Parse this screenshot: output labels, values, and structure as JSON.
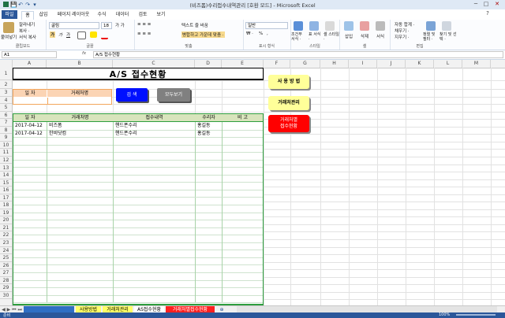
{
  "window": {
    "title": "(비즈폼)수리접수내역관리 [호환 모드] - Microsoft Excel"
  },
  "quick_access": {
    "save": "💾",
    "undo": "↶",
    "redo": "↷",
    "customize": "▾"
  },
  "window_controls": {
    "minimize": "─",
    "restore": "□",
    "close": "✕"
  },
  "ribbon_tabs": [
    "파일",
    "홈",
    "삽입",
    "페이지 레이아웃",
    "수식",
    "데이터",
    "검토",
    "보기"
  ],
  "ribbon": {
    "clipboard": {
      "paste": "붙여넣기",
      "cut": "잘라내기",
      "copy": "복사 ·",
      "format_painter": "서식 복사",
      "label": "클립보드"
    },
    "font": {
      "name": "굴림",
      "size": "18",
      "bold": "가",
      "italic": "가",
      "underline": "가",
      "label": "글꼴"
    },
    "alignment": {
      "wrap": "텍스트 줄 바꿈",
      "merge": "병합하고 가운데 맞춤 ·",
      "label": "맞춤"
    },
    "number": {
      "format": "일반",
      "currency": "₩ ·",
      "percent": "%",
      "comma": ",",
      "label": "표시 형식"
    },
    "styles": {
      "conditional": "조건부 서식 ·",
      "table": "표 서식 ·",
      "cell": "셀 스타일 ·",
      "label": "스타일"
    },
    "cells": {
      "insert": "삽입",
      "delete": "삭제",
      "format": "서식",
      "label": "셀"
    },
    "editing": {
      "autosum": "자동 합계 ·",
      "fill": "채우기 ·",
      "clear": "지우기 ·",
      "sort": "정렬 및 필터 ·",
      "find": "찾기 및 선택 ·",
      "label": "편집"
    }
  },
  "formula_bar": {
    "name_box": "A1",
    "fx": "fx",
    "formula": "A/S 접수현황"
  },
  "columns": [
    "A",
    "B",
    "C",
    "D",
    "E",
    "F",
    "G",
    "H",
    "I",
    "J",
    "K",
    "L",
    "M"
  ],
  "rows": [
    "1",
    "2",
    "3",
    "4",
    "5",
    "6",
    "7",
    "8",
    "9",
    "10",
    "11",
    "12",
    "13",
    "14",
    "15",
    "16",
    "17",
    "18",
    "19",
    "20",
    "21",
    "22",
    "23",
    "24",
    "25",
    "26",
    "27",
    "28",
    "29",
    "30"
  ],
  "sheet": {
    "title": "A/S 접수현황",
    "search_header": {
      "date": "일  자",
      "client": "거래처명"
    },
    "buttons": {
      "search": "검   색",
      "show_all": "모두보기",
      "usage": "사 용 방 법",
      "client_mgmt": "거래처관리",
      "client_status": "거래처별\n접수현황"
    },
    "table_headers": [
      "일  자",
      "거래처명",
      "접수내역",
      "수리자",
      "비  고"
    ],
    "table_rows": [
      [
        "2017-04-12",
        "비즈폼",
        "핸드폰수리",
        "홍길동",
        ""
      ],
      [
        "2017-04-12",
        "한비닷컴",
        "핸드폰수리",
        "홍길동",
        ""
      ]
    ]
  },
  "sheet_tabs": [
    "◀ ▶ ⏮ ⏭",
    "사용방법",
    "거래처관리",
    "AS접수현황",
    "거래처별접수현황"
  ],
  "status": {
    "ready": "준비",
    "zoom": "100%"
  }
}
